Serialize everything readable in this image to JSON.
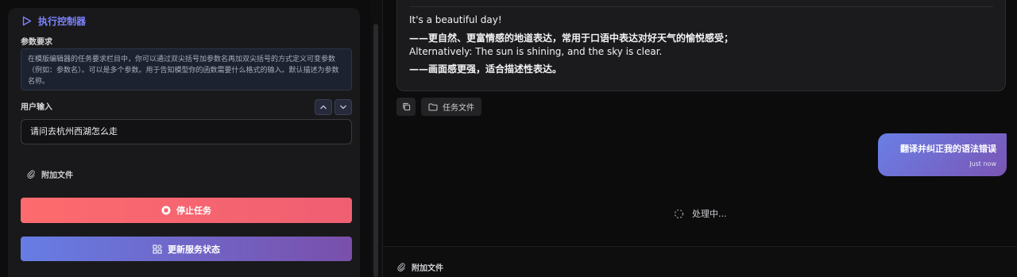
{
  "left": {
    "exec_title": "执行控制器",
    "param_label": "参数要求",
    "param_desc": "在模版编辑器的任务要求栏目中，你可以通过双尖括号加参数名再加双尖括号的方式定义可变参数（例如：参数名）。可以是多个参数。用于告知模型你的函数需要什么格式的输入。默认描述为参数名称。",
    "user_input_label": "用户输入",
    "user_input_value": "请问去杭州西湖怎么走",
    "attach_label": "附加文件",
    "stop_label": "停止任务",
    "refresh_label": "更新服务状态"
  },
  "right": {
    "message_lines": [
      "It's a beautiful day!",
      "——更自然、更富情感的地道表达，常用于口语中表达对好天气的愉悦感受；",
      "Alternatively: The sun is shining, and the sky is clear.",
      "——画面感更强，适合描述性表达。"
    ],
    "task_file_label": "任务文件",
    "user_message": "翻译并纠正我的语法错误",
    "user_timestamp": "Just now",
    "processing_text": "处理中...",
    "footer_attach_label": "附加文件"
  },
  "colors": {
    "accent": "#7c83ff",
    "stop_gradient": [
      "#fd6b6e",
      "#ef5f72"
    ],
    "refresh_gradient": [
      "#667de4",
      "#7a4fab"
    ],
    "bubble_gradient": [
      "#6a7fe6",
      "#7a55b5"
    ]
  },
  "icons": [
    "play-icon",
    "chevron-up-icon",
    "chevron-down-icon",
    "paperclip-icon",
    "stop-icon",
    "services-icon",
    "copy-icon",
    "folder-icon",
    "spinner-icon"
  ]
}
